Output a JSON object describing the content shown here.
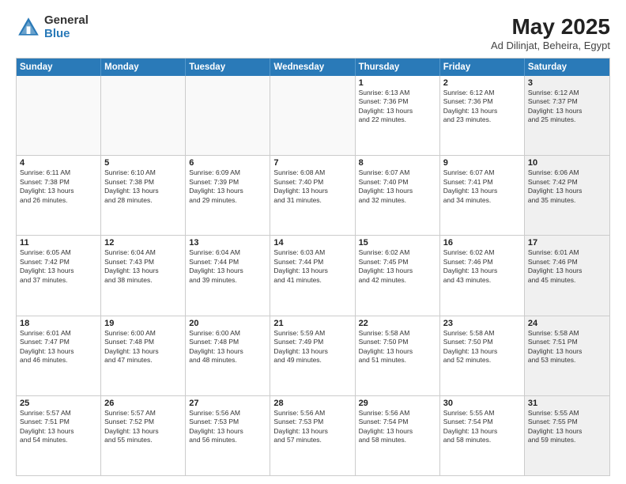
{
  "header": {
    "logo_general": "General",
    "logo_blue": "Blue",
    "title": "May 2025",
    "location": "Ad Dilinjat, Beheira, Egypt"
  },
  "calendar": {
    "days_of_week": [
      "Sunday",
      "Monday",
      "Tuesday",
      "Wednesday",
      "Thursday",
      "Friday",
      "Saturday"
    ],
    "rows": [
      [
        {
          "day": "",
          "info": "",
          "empty": true
        },
        {
          "day": "",
          "info": "",
          "empty": true
        },
        {
          "day": "",
          "info": "",
          "empty": true
        },
        {
          "day": "",
          "info": "",
          "empty": true
        },
        {
          "day": "1",
          "info": "Sunrise: 6:13 AM\nSunset: 7:36 PM\nDaylight: 13 hours\nand 22 minutes."
        },
        {
          "day": "2",
          "info": "Sunrise: 6:12 AM\nSunset: 7:36 PM\nDaylight: 13 hours\nand 23 minutes."
        },
        {
          "day": "3",
          "info": "Sunrise: 6:12 AM\nSunset: 7:37 PM\nDaylight: 13 hours\nand 25 minutes.",
          "shaded": true
        }
      ],
      [
        {
          "day": "4",
          "info": "Sunrise: 6:11 AM\nSunset: 7:38 PM\nDaylight: 13 hours\nand 26 minutes."
        },
        {
          "day": "5",
          "info": "Sunrise: 6:10 AM\nSunset: 7:38 PM\nDaylight: 13 hours\nand 28 minutes."
        },
        {
          "day": "6",
          "info": "Sunrise: 6:09 AM\nSunset: 7:39 PM\nDaylight: 13 hours\nand 29 minutes."
        },
        {
          "day": "7",
          "info": "Sunrise: 6:08 AM\nSunset: 7:40 PM\nDaylight: 13 hours\nand 31 minutes."
        },
        {
          "day": "8",
          "info": "Sunrise: 6:07 AM\nSunset: 7:40 PM\nDaylight: 13 hours\nand 32 minutes."
        },
        {
          "day": "9",
          "info": "Sunrise: 6:07 AM\nSunset: 7:41 PM\nDaylight: 13 hours\nand 34 minutes."
        },
        {
          "day": "10",
          "info": "Sunrise: 6:06 AM\nSunset: 7:42 PM\nDaylight: 13 hours\nand 35 minutes.",
          "shaded": true
        }
      ],
      [
        {
          "day": "11",
          "info": "Sunrise: 6:05 AM\nSunset: 7:42 PM\nDaylight: 13 hours\nand 37 minutes."
        },
        {
          "day": "12",
          "info": "Sunrise: 6:04 AM\nSunset: 7:43 PM\nDaylight: 13 hours\nand 38 minutes."
        },
        {
          "day": "13",
          "info": "Sunrise: 6:04 AM\nSunset: 7:44 PM\nDaylight: 13 hours\nand 39 minutes."
        },
        {
          "day": "14",
          "info": "Sunrise: 6:03 AM\nSunset: 7:44 PM\nDaylight: 13 hours\nand 41 minutes."
        },
        {
          "day": "15",
          "info": "Sunrise: 6:02 AM\nSunset: 7:45 PM\nDaylight: 13 hours\nand 42 minutes."
        },
        {
          "day": "16",
          "info": "Sunrise: 6:02 AM\nSunset: 7:46 PM\nDaylight: 13 hours\nand 43 minutes."
        },
        {
          "day": "17",
          "info": "Sunrise: 6:01 AM\nSunset: 7:46 PM\nDaylight: 13 hours\nand 45 minutes.",
          "shaded": true
        }
      ],
      [
        {
          "day": "18",
          "info": "Sunrise: 6:01 AM\nSunset: 7:47 PM\nDaylight: 13 hours\nand 46 minutes."
        },
        {
          "day": "19",
          "info": "Sunrise: 6:00 AM\nSunset: 7:48 PM\nDaylight: 13 hours\nand 47 minutes."
        },
        {
          "day": "20",
          "info": "Sunrise: 6:00 AM\nSunset: 7:48 PM\nDaylight: 13 hours\nand 48 minutes."
        },
        {
          "day": "21",
          "info": "Sunrise: 5:59 AM\nSunset: 7:49 PM\nDaylight: 13 hours\nand 49 minutes."
        },
        {
          "day": "22",
          "info": "Sunrise: 5:58 AM\nSunset: 7:50 PM\nDaylight: 13 hours\nand 51 minutes."
        },
        {
          "day": "23",
          "info": "Sunrise: 5:58 AM\nSunset: 7:50 PM\nDaylight: 13 hours\nand 52 minutes."
        },
        {
          "day": "24",
          "info": "Sunrise: 5:58 AM\nSunset: 7:51 PM\nDaylight: 13 hours\nand 53 minutes.",
          "shaded": true
        }
      ],
      [
        {
          "day": "25",
          "info": "Sunrise: 5:57 AM\nSunset: 7:51 PM\nDaylight: 13 hours\nand 54 minutes."
        },
        {
          "day": "26",
          "info": "Sunrise: 5:57 AM\nSunset: 7:52 PM\nDaylight: 13 hours\nand 55 minutes."
        },
        {
          "day": "27",
          "info": "Sunrise: 5:56 AM\nSunset: 7:53 PM\nDaylight: 13 hours\nand 56 minutes."
        },
        {
          "day": "28",
          "info": "Sunrise: 5:56 AM\nSunset: 7:53 PM\nDaylight: 13 hours\nand 57 minutes."
        },
        {
          "day": "29",
          "info": "Sunrise: 5:56 AM\nSunset: 7:54 PM\nDaylight: 13 hours\nand 58 minutes."
        },
        {
          "day": "30",
          "info": "Sunrise: 5:55 AM\nSunset: 7:54 PM\nDaylight: 13 hours\nand 58 minutes."
        },
        {
          "day": "31",
          "info": "Sunrise: 5:55 AM\nSunset: 7:55 PM\nDaylight: 13 hours\nand 59 minutes.",
          "shaded": true
        }
      ]
    ]
  }
}
